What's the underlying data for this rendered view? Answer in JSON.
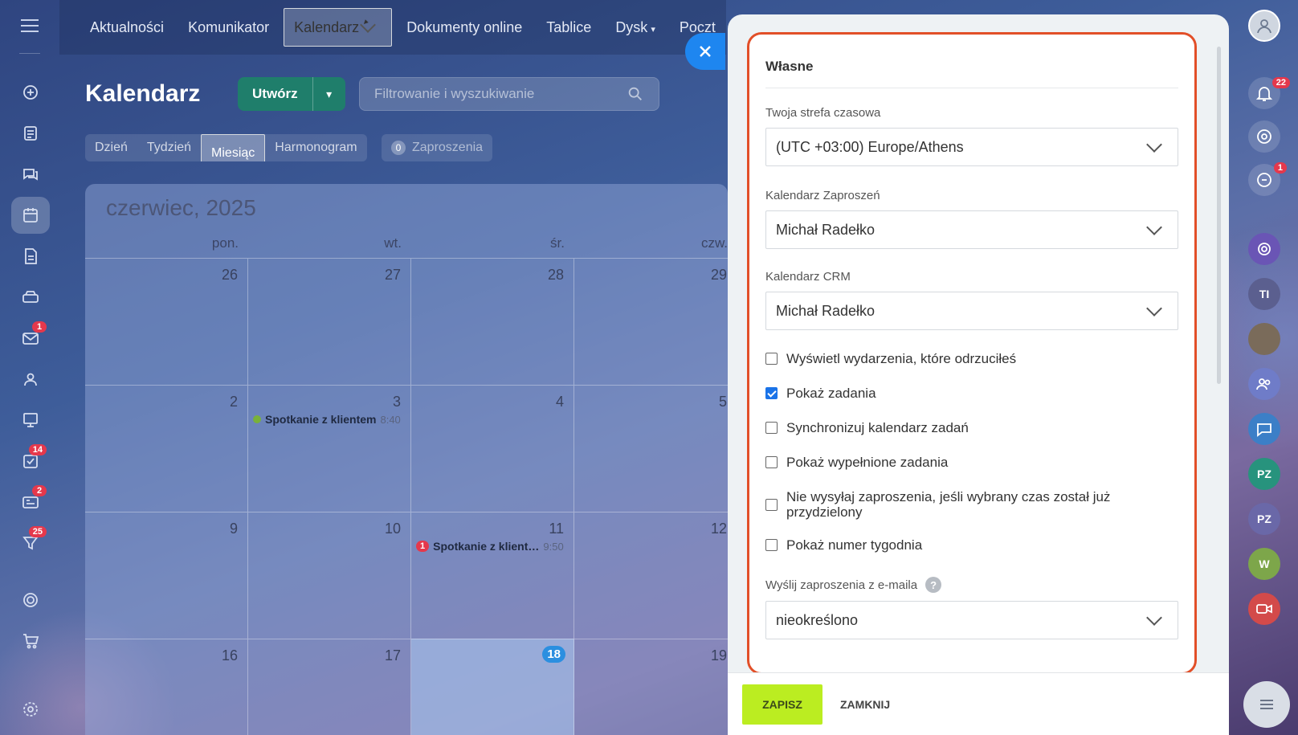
{
  "nav": {
    "items": [
      "Aktualności",
      "Komunikator",
      "Kalendarz",
      "Dokumenty online",
      "Tablice",
      "Dysk",
      "Poczt"
    ],
    "selected": "Kalendarz"
  },
  "rail_badges": {
    "mail": "1",
    "tasks": "14",
    "feed": "2",
    "crm": "25"
  },
  "calendar": {
    "title": "Kalendarz",
    "create_label": "Utwórz",
    "search_placeholder": "Filtrowanie i wyszukiwanie",
    "views": [
      "Dzień",
      "Tydzień",
      "Miesiąc",
      "Harmonogram"
    ],
    "selected_view": "Miesiąc",
    "invitations_count": "0",
    "invitations_label": "Zaproszenia",
    "month": "czerwiec,",
    "year": "2025",
    "weekdays": [
      "pon.",
      "wt.",
      "śr.",
      "czw."
    ],
    "weeks": [
      [
        "26",
        "27",
        "28",
        "29"
      ],
      [
        "2",
        "3",
        "4",
        "5"
      ],
      [
        "9",
        "10",
        "11",
        "12"
      ],
      [
        "16",
        "17",
        "18",
        "19"
      ]
    ],
    "events": [
      {
        "title": "Spotkanie z klientem",
        "time": "8:40"
      },
      {
        "badge": "1",
        "title": "Spotkanie z klient…",
        "time": "9:50"
      }
    ]
  },
  "settings": {
    "section_title": "Własne",
    "timezone_label": "Twoja strefa czasowa",
    "timezone_value": "(UTC +03:00) Europe/Athens",
    "invites_calendar_label": "Kalendarz Zaproszeń",
    "invites_calendar_value": "Michał Radełko",
    "crm_calendar_label": "Kalendarz CRM",
    "crm_calendar_value": "Michał Radełko",
    "checkboxes": [
      {
        "label": "Wyświetl wydarzenia, które odrzuciłeś",
        "checked": false
      },
      {
        "label": "Pokaż zadania",
        "checked": true
      },
      {
        "label": "Synchronizuj kalendarz zadań",
        "checked": false
      },
      {
        "label": "Pokaż wypełnione zadania",
        "checked": false
      },
      {
        "label": "Nie wysyłaj zaproszenia, jeśli wybrany czas został już przydzielony",
        "checked": false
      },
      {
        "label": "Pokaż numer tygodnia",
        "checked": false
      }
    ],
    "email_label": "Wyślij zaproszenia z e-maila",
    "email_value": "nieokreślono",
    "save_label": "ZAPISZ",
    "close_label": "ZAMKNIJ"
  },
  "right_rail": {
    "notifications_count": "22",
    "chat_count": "1",
    "avatar_initials": [
      "TI",
      "PZ",
      "PZ",
      "W"
    ]
  },
  "colors": {
    "accent_blue": "#1e86f0",
    "save_green": "#bbed21",
    "highlight": "#e24f28",
    "badge_red": "#e5384c"
  }
}
